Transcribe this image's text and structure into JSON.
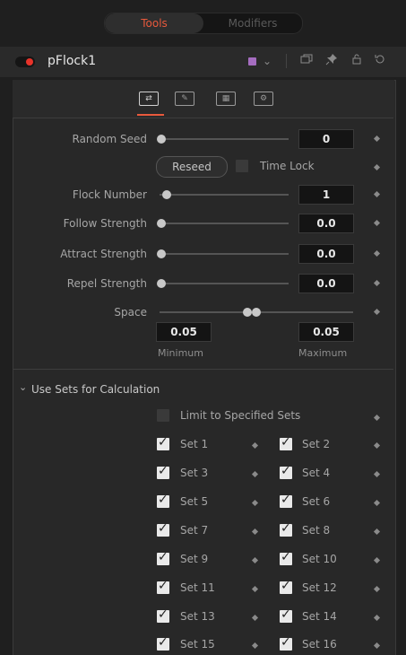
{
  "tabs": {
    "tools": "Tools",
    "modifiers": "Modifiers"
  },
  "header": {
    "title": "pFlock1",
    "swatch_color": "#a56dc0"
  },
  "colors": {
    "accent": "#e8593c",
    "toggle_on": "#e8332a"
  },
  "params": {
    "random_seed": {
      "label": "Random Seed",
      "value": "0"
    },
    "reseed": "Reseed",
    "time_lock": "Time Lock",
    "flock_number": {
      "label": "Flock Number",
      "value": "1"
    },
    "follow_strength": {
      "label": "Follow Strength",
      "value": "0.0"
    },
    "attract_strength": {
      "label": "Attract Strength",
      "value": "0.0"
    },
    "repel_strength": {
      "label": "Repel Strength",
      "value": "0.0"
    },
    "space": {
      "label": "Space",
      "min_value": "0.05",
      "max_value": "0.05",
      "min_label": "Minimum",
      "max_label": "Maximum"
    }
  },
  "sets_section": {
    "title": "Use Sets for Calculation",
    "limit": "Limit to Specified Sets",
    "sets": [
      "Set 1",
      "Set 2",
      "Set 3",
      "Set 4",
      "Set 5",
      "Set 6",
      "Set 7",
      "Set 8",
      "Set 9",
      "Set 10",
      "Set 11",
      "Set 12",
      "Set 13",
      "Set 14",
      "Set 15",
      "Set 16"
    ]
  }
}
